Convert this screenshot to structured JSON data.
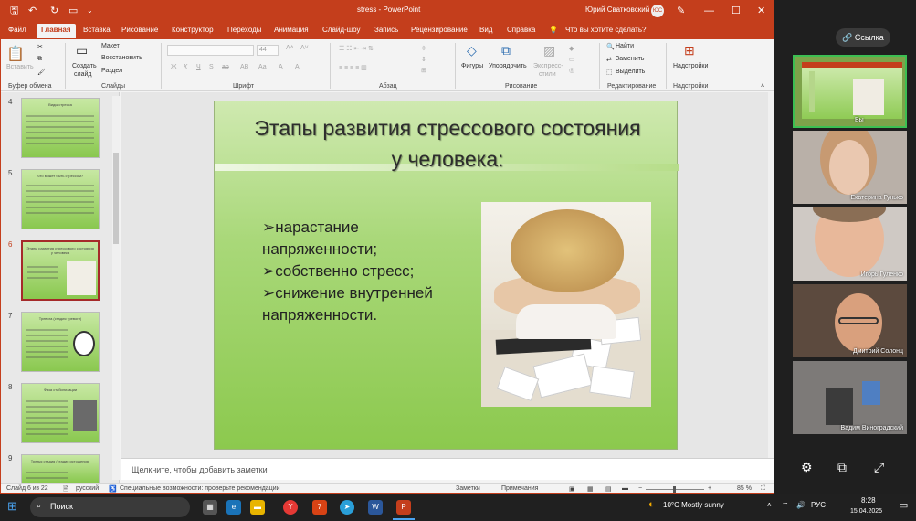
{
  "titlebar": {
    "doc_title": "stress  -  PowerPoint",
    "user": "Юрий Сватковский",
    "avatar": "ЮС",
    "icons": [
      "save-icon",
      "undo-icon",
      "redo-icon",
      "slideshow-icon",
      "customize-icon",
      "minimize-icon",
      "restore-icon",
      "close-icon"
    ]
  },
  "tabs": [
    "Файл",
    "Главная",
    "Вставка",
    "Рисование",
    "Конструктор",
    "Переходы",
    "Анимация",
    "Слайд-шоу",
    "Запись",
    "Рецензирование",
    "Вид",
    "Справка"
  ],
  "active_tab": "Главная",
  "tell_me": "Что вы хотите сделать?",
  "ribbon": {
    "clipboard": {
      "paste": "Вставить",
      "label": "Буфер обмена"
    },
    "slides": {
      "create": "Создать",
      "create2": "слайд",
      "layout": "Макет",
      "reset": "Восстановить",
      "section": "Раздел",
      "label": "Слайды"
    },
    "font": {
      "size": "44",
      "label": "Шрифт",
      "buttons": [
        "Ж",
        "К",
        "Ч",
        "S",
        "ab",
        "АВ",
        "Аа",
        "А",
        "А"
      ]
    },
    "paragraph": {
      "label": "Абзац"
    },
    "drawing": {
      "shapes": "Фигуры",
      "arrange": "Упорядочить",
      "styles": "Экспресс-",
      "styles2": "стили",
      "label": "Рисование"
    },
    "editing": {
      "find": "Найти",
      "replace": "Заменить",
      "select": "Выделить",
      "label": "Редактирование"
    },
    "addins": {
      "button": "Надстройки",
      "label": "Надстройки"
    }
  },
  "thumbnails": [
    {
      "num": "4",
      "title": "Виды стресса",
      "current": false
    },
    {
      "num": "5",
      "title": "Что может быть стрессом?",
      "current": false
    },
    {
      "num": "6",
      "title": "Этапы развития стрессового состояния у человека",
      "current": true
    },
    {
      "num": "7",
      "title": "Тревога (стадия тревоги)",
      "current": false
    },
    {
      "num": "8",
      "title": "Фаза стабилизации",
      "current": false
    },
    {
      "num": "9",
      "title": "Третья стадия (стадия истощения)",
      "current": false
    }
  ],
  "slide": {
    "title": "Этапы развития стрессового состояния у человека:",
    "bullets": [
      "➢нарастание напряженности;",
      "➢собственно стресс;",
      "➢снижение внутренней напряженности."
    ]
  },
  "notes_placeholder": "Щелкните, чтобы добавить заметки",
  "status": {
    "slide_count": "Слайд 6 из 22",
    "language": "русский",
    "accessibility": "Специальные возможности: проверьте рекомендации",
    "notes": "Заметки",
    "comments": "Примечания",
    "zoom": "85 %"
  },
  "meeting": {
    "link_button": "Ссылка",
    "participants": [
      {
        "name": "Вы",
        "self": true
      },
      {
        "name": "Екатерина Гунько",
        "self": false
      },
      {
        "name": "Игорь Гуленко",
        "self": false
      },
      {
        "name": "Дмитрий Солонц",
        "self": false
      },
      {
        "name": "Вадим Виноградский",
        "self": false
      }
    ],
    "controls": [
      "settings-icon",
      "picture-in-picture-icon",
      "fullscreen-icon"
    ]
  },
  "taskbar": {
    "search": "Поиск",
    "weather": "10°C  Mostly sunny",
    "lang": "РУС",
    "time": "8:28",
    "date": "15.04.2025"
  }
}
